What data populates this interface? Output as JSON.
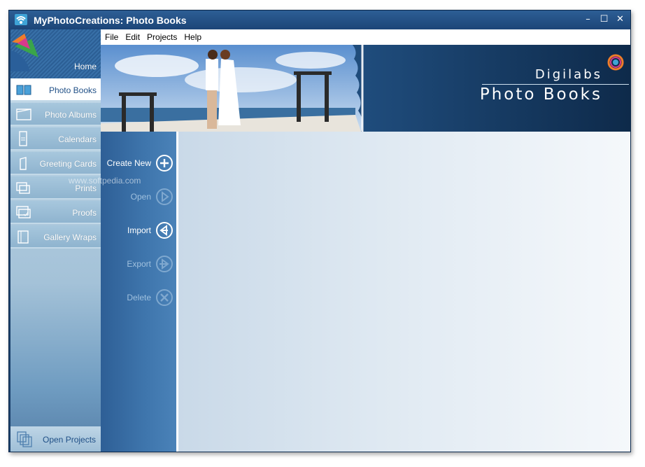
{
  "window": {
    "title": "MyPhotoCreations: Photo Books",
    "controls": {
      "minimize": "–",
      "maximize": "☐",
      "close": "✕"
    }
  },
  "menu": {
    "items": [
      "File",
      "Edit",
      "Projects",
      "Help"
    ]
  },
  "sidebar": {
    "home": "Home",
    "items": [
      {
        "label": "Photo Books",
        "icon": "photo-book-icon",
        "active": true
      },
      {
        "label": "Photo Albums",
        "icon": "photo-album-icon"
      },
      {
        "label": "Calendars",
        "icon": "calendar-icon"
      },
      {
        "label": "Greeting Cards",
        "icon": "greeting-card-icon"
      },
      {
        "label": "Prints",
        "icon": "prints-icon"
      },
      {
        "label": "Proofs",
        "icon": "proofs-icon"
      },
      {
        "label": "Gallery Wraps",
        "icon": "gallery-wrap-icon"
      }
    ],
    "open_projects": "Open Projects"
  },
  "banner": {
    "brand": "Digilabs",
    "product": "Photo Books"
  },
  "actions": [
    {
      "label": "Create New",
      "icon": "plus-circle-icon",
      "enabled": true
    },
    {
      "label": "Open",
      "icon": "play-circle-icon",
      "enabled": false
    },
    {
      "label": "Import",
      "icon": "import-circle-icon",
      "enabled": true
    },
    {
      "label": "Export",
      "icon": "export-circle-icon",
      "enabled": false
    },
    {
      "label": "Delete",
      "icon": "x-circle-icon",
      "enabled": false
    }
  ],
  "watermark": "www.softpedia.com",
  "colors": {
    "titlebar": "#1c4577",
    "sidebar_active": "#ffffff",
    "accent": "#1f4f86"
  }
}
